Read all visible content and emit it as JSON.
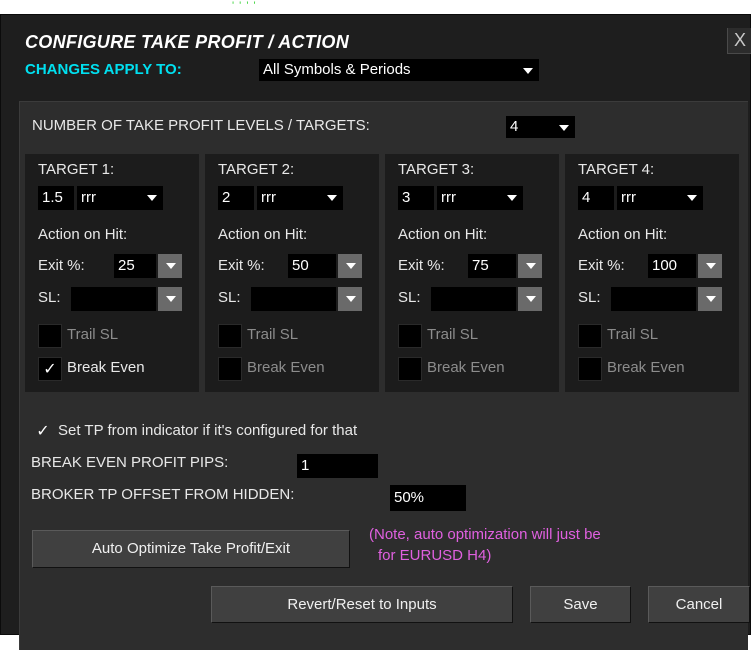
{
  "top_marks": "' ' ' '",
  "title": "CONFIGURE TAKE PROFIT / ACTION",
  "close_label": "X",
  "changes_apply": {
    "label": "CHANGES APPLY TO:",
    "value": "All Symbols & Periods"
  },
  "levels": {
    "label": "NUMBER OF TAKE PROFIT LEVELS / TARGETS:",
    "value": "4"
  },
  "targets": [
    {
      "label": "TARGET 1:",
      "value": "1.5",
      "unit": "rrr",
      "action_label": "Action on Hit:",
      "exit_label": "Exit %:",
      "exit_value": "25",
      "sl_label": "SL:",
      "sl_value": "",
      "trail_label": "Trail SL",
      "trail_checked": "",
      "be_label": "Break Even",
      "be_checked": "✓"
    },
    {
      "label": "TARGET 2:",
      "value": "2",
      "unit": "rrr",
      "action_label": "Action on Hit:",
      "exit_label": "Exit %:",
      "exit_value": "50",
      "sl_label": "SL:",
      "sl_value": "",
      "trail_label": "Trail SL",
      "trail_checked": "",
      "be_label": "Break Even",
      "be_checked": ""
    },
    {
      "label": "TARGET 3:",
      "value": "3",
      "unit": "rrr",
      "action_label": "Action on Hit:",
      "exit_label": "Exit %:",
      "exit_value": "75",
      "sl_label": "SL:",
      "sl_value": "",
      "trail_label": "Trail SL",
      "trail_checked": "",
      "be_label": "Break Even",
      "be_checked": ""
    },
    {
      "label": "TARGET 4:",
      "value": "4",
      "unit": "rrr",
      "action_label": "Action on Hit:",
      "exit_label": "Exit %:",
      "exit_value": "100",
      "sl_label": "SL:",
      "sl_value": "",
      "trail_label": "Trail SL",
      "trail_checked": "",
      "be_label": "Break Even",
      "be_checked": ""
    }
  ],
  "set_tp": {
    "checked": "✓",
    "label": "Set TP from indicator if it's configured for that"
  },
  "break_even_pips": {
    "label": "BREAK EVEN PROFIT PIPS:",
    "value": "1"
  },
  "broker_offset": {
    "label": "BROKER TP OFFSET FROM HIDDEN:",
    "value": "50%"
  },
  "auto_optimize_label": "Auto Optimize Take Profit/Exit",
  "note_line1": "(Note, auto optimization will just be",
  "note_line2": "for EURUSD H4)",
  "buttons": {
    "revert": "Revert/Reset to Inputs",
    "save": "Save",
    "cancel": "Cancel"
  },
  "colors": {
    "title": "#ffffff",
    "accent": "#00e0f0",
    "note": "#e060e0",
    "tick": "#3fd43f"
  }
}
